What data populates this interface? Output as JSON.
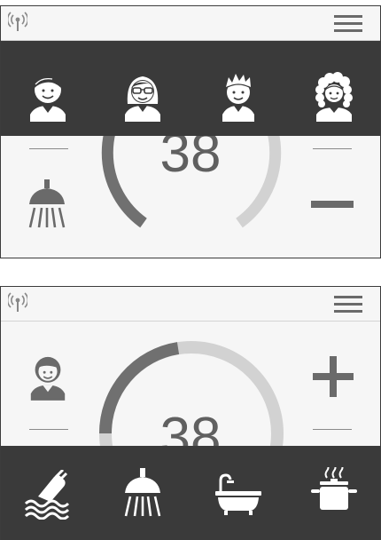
{
  "panel_top": {
    "header": {
      "antenna_icon": "broadcast-icon",
      "menu_icon": "hamburger-icon"
    },
    "users": [
      {
        "icon": "boy-avatar-icon"
      },
      {
        "icon": "girl-glasses-avatar-icon"
      },
      {
        "icon": "spiky-boy-avatar-icon"
      },
      {
        "icon": "curly-woman-avatar-icon"
      }
    ],
    "temperature": "38",
    "mode_icon": "shower-icon",
    "decrease_icon": "minus-icon"
  },
  "panel_bottom": {
    "header": {
      "antenna_icon": "broadcast-icon",
      "menu_icon": "hamburger-icon"
    },
    "temperature": "38",
    "user_icon": "boy-avatar-icon",
    "increase_icon": "plus-icon",
    "modes": [
      {
        "icon": "hand-wash-icon"
      },
      {
        "icon": "shower-icon"
      },
      {
        "icon": "bathtub-icon"
      },
      {
        "icon": "cooking-pot-icon"
      }
    ]
  },
  "colors": {
    "band": "#3a3a3a",
    "gauge_active": "#707070",
    "gauge_inactive": "#d2d2d2",
    "icon_light": "#ffffff",
    "icon_dark": "#6a6a6a"
  }
}
